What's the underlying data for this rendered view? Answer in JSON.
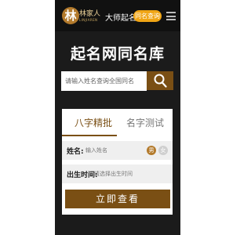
{
  "header": {
    "logo_char": "林",
    "logo_title": "林家人",
    "logo_subtitle": "LINJIAREN",
    "nav_link": "大师起名",
    "nav_button": "同名查询",
    "menu_icon": "menu-icon"
  },
  "hero": {
    "title": "起名网同名库"
  },
  "search": {
    "placeholder": "请输入姓名查询全国同名",
    "icon": "search-icon"
  },
  "tabs": {
    "active": "八字精批",
    "inactive": "名字测试"
  },
  "form": {
    "name_label": "姓名:",
    "name_placeholder": "输入姓名",
    "gender_male": "男",
    "gender_female": "女",
    "birth_label": "出生时间:",
    "birth_placeholder": "请选择出生时间",
    "submit": "立即查看"
  },
  "colors": {
    "accent": "#7a4f14",
    "nav_button": "#f0a515",
    "background_dark": "#1b1b1b"
  }
}
